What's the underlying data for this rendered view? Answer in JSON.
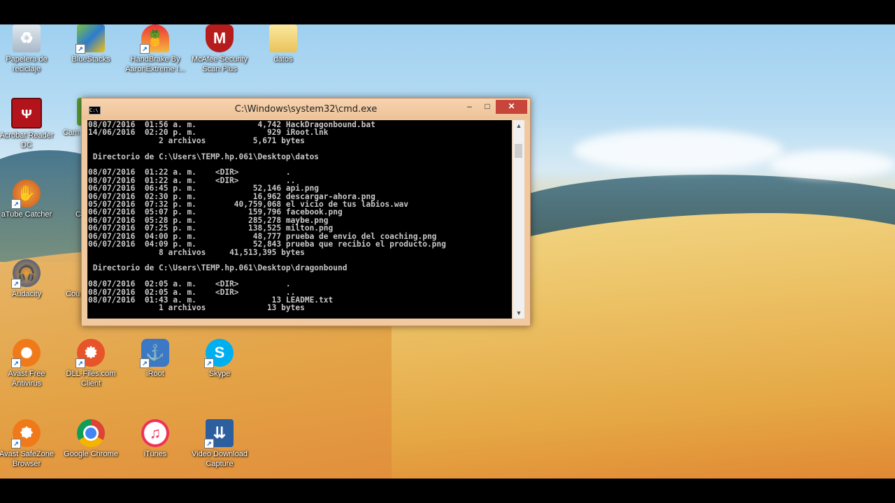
{
  "desktop_icons": [
    {
      "label": "Papelera de reciclaje"
    },
    {
      "label": "BlueStacks"
    },
    {
      "label": "HandBrake By AaronExtreme I..."
    },
    {
      "label": "McAfee Security Scan Plus"
    },
    {
      "label": "datos"
    },
    {
      "label": "Acrobat Reader DC"
    },
    {
      "label": "Cam"
    },
    {
      "label": "aTube Catcher"
    },
    {
      "label": "C"
    },
    {
      "label": "Audacity"
    },
    {
      "label": "Cou"
    },
    {
      "label": "Avast Free Antivirus"
    },
    {
      "label": "DLL-Files.com Client"
    },
    {
      "label": "iRoot"
    },
    {
      "label": "Skype"
    },
    {
      "label": "Avast SafeZone Browser"
    },
    {
      "label": "Google Chrome"
    },
    {
      "label": "iTunes"
    },
    {
      "label": "Video Download Capture"
    }
  ],
  "window": {
    "title": "C:\\Windows\\system32\\cmd.exe",
    "icon_text": "C:\\",
    "min": "–",
    "max": "□",
    "close": "✕",
    "console_lines": [
      "08/07/2016  01:56 a. m.             4,742 HackDragonbound.bat",
      "14/06/2016  02:20 p. m.               929 iRoot.lnk",
      "               2 archivos          5,671 bytes",
      "",
      " Directorio de C:\\Users\\TEMP.hp.061\\Desktop\\datos",
      "",
      "08/07/2016  01:22 a. m.    <DIR>          .",
      "08/07/2016  01:22 a. m.    <DIR>          ..",
      "06/07/2016  06:45 p. m.            52,146 api.png",
      "06/07/2016  02:30 p. m.            16,962 descargar-ahora.png",
      "05/07/2016  07:32 p. m.        40,759,068 el vicio de tus labios.wav",
      "06/07/2016  05:07 p. m.           159,796 facebook.png",
      "06/07/2016  05:28 p. m.           285,278 maybe.png",
      "06/07/2016  07:25 p. m.           138,525 milton.png",
      "06/07/2016  04:00 p. m.            48,777 prueba de envio del coaching.png",
      "06/07/2016  04:09 p. m.            52,843 prueba que recibio el producto.png",
      "               8 archivos     41,513,395 bytes",
      "",
      " Directorio de C:\\Users\\TEMP.hp.061\\Desktop\\dragonbound",
      "",
      "08/07/2016  02:05 a. m.    <DIR>          .",
      "08/07/2016  02:05 a. m.    <DIR>          ..",
      "08/07/2016  01:43 a. m.                13 LEADME.txt",
      "               1 archivos             13 bytes"
    ]
  },
  "scrollbar": {
    "up": "▲",
    "down": "▼"
  }
}
